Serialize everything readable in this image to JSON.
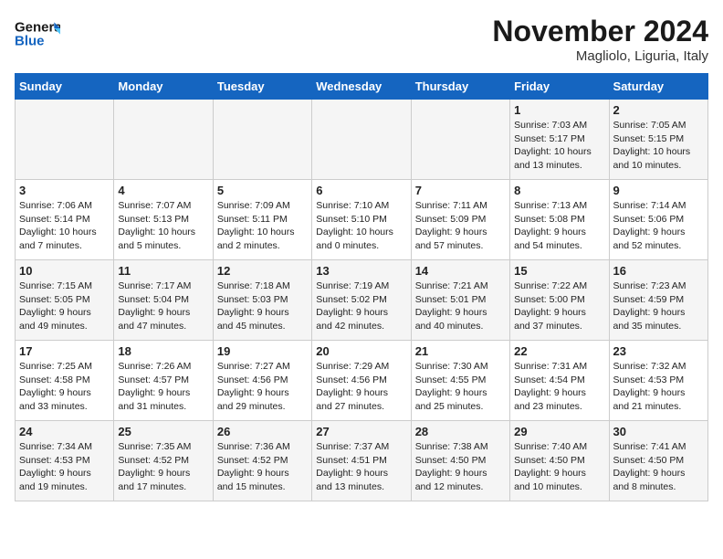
{
  "header": {
    "logo_general": "General",
    "logo_blue": "Blue",
    "month_title": "November 2024",
    "location": "Magliolo, Liguria, Italy"
  },
  "weekdays": [
    "Sunday",
    "Monday",
    "Tuesday",
    "Wednesday",
    "Thursday",
    "Friday",
    "Saturday"
  ],
  "weeks": [
    [
      {
        "day": "",
        "info": ""
      },
      {
        "day": "",
        "info": ""
      },
      {
        "day": "",
        "info": ""
      },
      {
        "day": "",
        "info": ""
      },
      {
        "day": "",
        "info": ""
      },
      {
        "day": "1",
        "info": "Sunrise: 7:03 AM\nSunset: 5:17 PM\nDaylight: 10 hours\nand 13 minutes."
      },
      {
        "day": "2",
        "info": "Sunrise: 7:05 AM\nSunset: 5:15 PM\nDaylight: 10 hours\nand 10 minutes."
      }
    ],
    [
      {
        "day": "3",
        "info": "Sunrise: 7:06 AM\nSunset: 5:14 PM\nDaylight: 10 hours\nand 7 minutes."
      },
      {
        "day": "4",
        "info": "Sunrise: 7:07 AM\nSunset: 5:13 PM\nDaylight: 10 hours\nand 5 minutes."
      },
      {
        "day": "5",
        "info": "Sunrise: 7:09 AM\nSunset: 5:11 PM\nDaylight: 10 hours\nand 2 minutes."
      },
      {
        "day": "6",
        "info": "Sunrise: 7:10 AM\nSunset: 5:10 PM\nDaylight: 10 hours\nand 0 minutes."
      },
      {
        "day": "7",
        "info": "Sunrise: 7:11 AM\nSunset: 5:09 PM\nDaylight: 9 hours\nand 57 minutes."
      },
      {
        "day": "8",
        "info": "Sunrise: 7:13 AM\nSunset: 5:08 PM\nDaylight: 9 hours\nand 54 minutes."
      },
      {
        "day": "9",
        "info": "Sunrise: 7:14 AM\nSunset: 5:06 PM\nDaylight: 9 hours\nand 52 minutes."
      }
    ],
    [
      {
        "day": "10",
        "info": "Sunrise: 7:15 AM\nSunset: 5:05 PM\nDaylight: 9 hours\nand 49 minutes."
      },
      {
        "day": "11",
        "info": "Sunrise: 7:17 AM\nSunset: 5:04 PM\nDaylight: 9 hours\nand 47 minutes."
      },
      {
        "day": "12",
        "info": "Sunrise: 7:18 AM\nSunset: 5:03 PM\nDaylight: 9 hours\nand 45 minutes."
      },
      {
        "day": "13",
        "info": "Sunrise: 7:19 AM\nSunset: 5:02 PM\nDaylight: 9 hours\nand 42 minutes."
      },
      {
        "day": "14",
        "info": "Sunrise: 7:21 AM\nSunset: 5:01 PM\nDaylight: 9 hours\nand 40 minutes."
      },
      {
        "day": "15",
        "info": "Sunrise: 7:22 AM\nSunset: 5:00 PM\nDaylight: 9 hours\nand 37 minutes."
      },
      {
        "day": "16",
        "info": "Sunrise: 7:23 AM\nSunset: 4:59 PM\nDaylight: 9 hours\nand 35 minutes."
      }
    ],
    [
      {
        "day": "17",
        "info": "Sunrise: 7:25 AM\nSunset: 4:58 PM\nDaylight: 9 hours\nand 33 minutes."
      },
      {
        "day": "18",
        "info": "Sunrise: 7:26 AM\nSunset: 4:57 PM\nDaylight: 9 hours\nand 31 minutes."
      },
      {
        "day": "19",
        "info": "Sunrise: 7:27 AM\nSunset: 4:56 PM\nDaylight: 9 hours\nand 29 minutes."
      },
      {
        "day": "20",
        "info": "Sunrise: 7:29 AM\nSunset: 4:56 PM\nDaylight: 9 hours\nand 27 minutes."
      },
      {
        "day": "21",
        "info": "Sunrise: 7:30 AM\nSunset: 4:55 PM\nDaylight: 9 hours\nand 25 minutes."
      },
      {
        "day": "22",
        "info": "Sunrise: 7:31 AM\nSunset: 4:54 PM\nDaylight: 9 hours\nand 23 minutes."
      },
      {
        "day": "23",
        "info": "Sunrise: 7:32 AM\nSunset: 4:53 PM\nDaylight: 9 hours\nand 21 minutes."
      }
    ],
    [
      {
        "day": "24",
        "info": "Sunrise: 7:34 AM\nSunset: 4:53 PM\nDaylight: 9 hours\nand 19 minutes."
      },
      {
        "day": "25",
        "info": "Sunrise: 7:35 AM\nSunset: 4:52 PM\nDaylight: 9 hours\nand 17 minutes."
      },
      {
        "day": "26",
        "info": "Sunrise: 7:36 AM\nSunset: 4:52 PM\nDaylight: 9 hours\nand 15 minutes."
      },
      {
        "day": "27",
        "info": "Sunrise: 7:37 AM\nSunset: 4:51 PM\nDaylight: 9 hours\nand 13 minutes."
      },
      {
        "day": "28",
        "info": "Sunrise: 7:38 AM\nSunset: 4:50 PM\nDaylight: 9 hours\nand 12 minutes."
      },
      {
        "day": "29",
        "info": "Sunrise: 7:40 AM\nSunset: 4:50 PM\nDaylight: 9 hours\nand 10 minutes."
      },
      {
        "day": "30",
        "info": "Sunrise: 7:41 AM\nSunset: 4:50 PM\nDaylight: 9 hours\nand 8 minutes."
      }
    ]
  ]
}
